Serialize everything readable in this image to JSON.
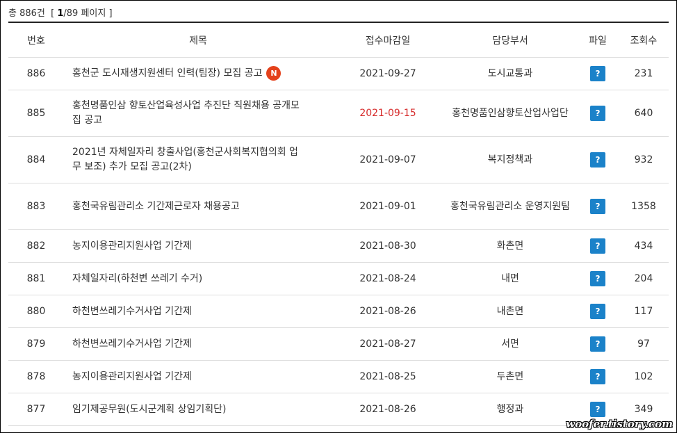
{
  "summary": {
    "prefix": "총 886건  [ ",
    "current_page": "1",
    "suffix": "/89 페이지 ]"
  },
  "columns": {
    "no": "번호",
    "title": "제목",
    "deadline": "접수마감일",
    "dept": "담당부서",
    "file": "파일",
    "views": "조회수"
  },
  "badge_new": "N",
  "file_icon_glyph": "?",
  "rows": [
    {
      "no": "886",
      "title": "홍천군 도시재생지원센터 인력(팀장) 모집 공고",
      "deadline": "2021-09-27",
      "dept": "도시교통과",
      "views": "231",
      "is_new": true,
      "deadline_red": false
    },
    {
      "no": "885",
      "title": "홍천명품인삼 향토산업육성사업 추진단 직원채용 공개모집 공고",
      "deadline": "2021-09-15",
      "dept": "홍천명품인삼향토산업사업단",
      "views": "640",
      "is_new": false,
      "deadline_red": true
    },
    {
      "no": "884",
      "title": "2021년 자체일자리 창출사업(홍천군사회복지협의회 업무 보조) 추가 모집 공고(2차)",
      "deadline": "2021-09-07",
      "dept": "복지정책과",
      "views": "932",
      "is_new": false,
      "deadline_red": false
    },
    {
      "no": "883",
      "title": "홍천국유림관리소 기간제근로자 채용공고",
      "deadline": "2021-09-01",
      "dept": "홍천국유림관리소 운영지원팀",
      "views": "1358",
      "is_new": false,
      "deadline_red": false
    },
    {
      "no": "882",
      "title": "농지이용관리지원사업 기간제",
      "deadline": "2021-08-30",
      "dept": "화촌면",
      "views": "434",
      "is_new": false,
      "deadline_red": false
    },
    {
      "no": "881",
      "title": "자체일자리(하천변 쓰레기 수거)",
      "deadline": "2021-08-24",
      "dept": "내면",
      "views": "204",
      "is_new": false,
      "deadline_red": false
    },
    {
      "no": "880",
      "title": "하천변쓰레기수거사업 기간제",
      "deadline": "2021-08-26",
      "dept": "내촌면",
      "views": "117",
      "is_new": false,
      "deadline_red": false
    },
    {
      "no": "879",
      "title": "하천변쓰레기수거사업 기간제",
      "deadline": "2021-08-27",
      "dept": "서면",
      "views": "97",
      "is_new": false,
      "deadline_red": false
    },
    {
      "no": "878",
      "title": "농지이용관리지원사업 기간제",
      "deadline": "2021-08-25",
      "dept": "두촌면",
      "views": "102",
      "is_new": false,
      "deadline_red": false
    },
    {
      "no": "877",
      "title": "임기제공무원(도시군계획 상임기획단)",
      "deadline": "2021-08-26",
      "dept": "행정과",
      "views": "349",
      "is_new": false,
      "deadline_red": false
    }
  ],
  "watermark": "woofer.tistory.com",
  "colors": {
    "accent_red": "#d62b2b",
    "badge": "#e4411b",
    "file_icon": "#1b82c9"
  }
}
